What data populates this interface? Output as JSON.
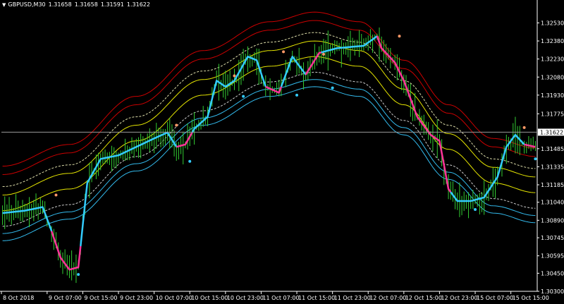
{
  "header": {
    "symbol": "GBPUSD,M30",
    "open": "1.31658",
    "high": "1.31658",
    "low": "1.31591",
    "close": "1.31622"
  },
  "colors": {
    "background": "#000000",
    "candle": "#33cc33",
    "signal_up": "#33ccff",
    "signal_down": "#ff3399",
    "band_red": "#cc0000",
    "band_yellow": "#e6e600",
    "band_cyan": "#33bbee",
    "dot_up": "#33ccff",
    "dot_down": "#ff9966"
  },
  "chart_data": {
    "type": "line",
    "current_price": 1.31622,
    "current_price_label": "1.31622",
    "ylim": [
      1.303,
      1.3265
    ],
    "y_ticks": [
      {
        "label": "1.32530",
        "value": 1.3253
      },
      {
        "label": "1.32380",
        "value": 1.3238
      },
      {
        "label": "1.32230",
        "value": 1.3223
      },
      {
        "label": "1.32080",
        "value": 1.3208
      },
      {
        "label": "1.31930",
        "value": 1.3193
      },
      {
        "label": "1.31775",
        "value": 1.31775
      },
      {
        "label": "1.31485",
        "value": 1.31485
      },
      {
        "label": "1.31335",
        "value": 1.31335
      },
      {
        "label": "1.31185",
        "value": 1.31185
      },
      {
        "label": "1.31040",
        "value": 1.3104
      },
      {
        "label": "1.30890",
        "value": 1.3089
      },
      {
        "label": "1.30745",
        "value": 1.30745
      },
      {
        "label": "1.30595",
        "value": 1.30595
      },
      {
        "label": "1.30450",
        "value": 1.3045
      },
      {
        "label": "1.30300",
        "value": 1.303
      }
    ],
    "x_ticks": [
      {
        "label": "8 Oct 2018",
        "bar": 0
      },
      {
        "label": "9 Oct 07:00",
        "bar": 20
      },
      {
        "label": "9 Oct 15:00",
        "bar": 36
      },
      {
        "label": "9 Oct 23:00",
        "bar": 52
      },
      {
        "label": "10 Oct 07:00",
        "bar": 68
      },
      {
        "label": "10 Oct 15:00",
        "bar": 84
      },
      {
        "label": "10 Oct 23:00",
        "bar": 100
      },
      {
        "label": "11 Oct 07:00",
        "bar": 116
      },
      {
        "label": "11 Oct 15:00",
        "bar": 132
      },
      {
        "label": "11 Oct 23:00",
        "bar": 148
      },
      {
        "label": "12 Oct 07:00",
        "bar": 164
      },
      {
        "label": "12 Oct 15:00",
        "bar": 180
      },
      {
        "label": "12 Oct 23:00",
        "bar": 196
      },
      {
        "label": "15 Oct 07:00",
        "bar": 212
      },
      {
        "label": "15 Oct 15:00",
        "bar": 228
      }
    ],
    "bar_count": 240,
    "price_path": [
      [
        0,
        1.3095
      ],
      [
        10,
        1.3097
      ],
      [
        18,
        1.31
      ],
      [
        22,
        1.308
      ],
      [
        26,
        1.3058
      ],
      [
        30,
        1.3048
      ],
      [
        34,
        1.305
      ],
      [
        38,
        1.312
      ],
      [
        44,
        1.314
      ],
      [
        52,
        1.3143
      ],
      [
        60,
        1.315
      ],
      [
        68,
        1.3157
      ],
      [
        74,
        1.3162
      ],
      [
        78,
        1.315
      ],
      [
        82,
        1.3152
      ],
      [
        86,
        1.3165
      ],
      [
        92,
        1.3175
      ],
      [
        96,
        1.3205
      ],
      [
        100,
        1.32
      ],
      [
        104,
        1.3205
      ],
      [
        110,
        1.3225
      ],
      [
        114,
        1.3222
      ],
      [
        118,
        1.32
      ],
      [
        124,
        1.3195
      ],
      [
        130,
        1.3225
      ],
      [
        136,
        1.321
      ],
      [
        142,
        1.3228
      ],
      [
        150,
        1.3232
      ],
      [
        156,
        1.3233
      ],
      [
        162,
        1.3234
      ],
      [
        168,
        1.3242
      ],
      [
        170,
        1.3232
      ],
      [
        176,
        1.322
      ],
      [
        180,
        1.3205
      ],
      [
        186,
        1.3175
      ],
      [
        192,
        1.316
      ],
      [
        196,
        1.3155
      ],
      [
        200,
        1.3115
      ],
      [
        204,
        1.3105
      ],
      [
        210,
        1.3105
      ],
      [
        216,
        1.3108
      ],
      [
        222,
        1.3125
      ],
      [
        226,
        1.315
      ],
      [
        230,
        1.316
      ],
      [
        234,
        1.3152
      ],
      [
        239,
        1.315
      ]
    ],
    "bands": [
      {
        "name": "red-outer",
        "color": "#cc0000",
        "offset": 0.0042,
        "dash": false
      },
      {
        "name": "red-inner",
        "color": "#cc0000",
        "offset": 0.0035,
        "dash": false
      },
      {
        "name": "white-upper",
        "color": "#ddddaa",
        "offset": 0.0025,
        "dash": true
      },
      {
        "name": "yellow-upper",
        "color": "#e6e600",
        "offset": 0.0018,
        "dash": false
      },
      {
        "name": "yellow-mid",
        "color": "#e6e600",
        "offset": 0.0005,
        "dash": false
      },
      {
        "name": "white-lower",
        "color": "#cccccc",
        "offset": -0.0008,
        "dash": true
      },
      {
        "name": "cyan-inner",
        "color": "#33bbee",
        "offset": -0.0014,
        "dash": false
      },
      {
        "name": "cyan-outer",
        "color": "#33bbee",
        "offset": -0.002,
        "dash": false
      }
    ],
    "band_center": [
      [
        0,
        1.3092
      ],
      [
        30,
        1.311
      ],
      [
        60,
        1.315
      ],
      [
        90,
        1.3188
      ],
      [
        120,
        1.3212
      ],
      [
        140,
        1.322
      ],
      [
        160,
        1.3212
      ],
      [
        180,
        1.318
      ],
      [
        200,
        1.3143
      ],
      [
        220,
        1.3115
      ],
      [
        239,
        1.3107
      ]
    ],
    "signal_dots": [
      {
        "bar": 24,
        "price": 1.311,
        "kind": "down"
      },
      {
        "bar": 34,
        "price": 1.3044,
        "kind": "up"
      },
      {
        "bar": 78,
        "price": 1.3168,
        "kind": "down"
      },
      {
        "bar": 84,
        "price": 1.3138,
        "kind": "up"
      },
      {
        "bar": 104,
        "price": 1.3209,
        "kind": "down"
      },
      {
        "bar": 108,
        "price": 1.3192,
        "kind": "up"
      },
      {
        "bar": 126,
        "price": 1.3229,
        "kind": "down"
      },
      {
        "bar": 132,
        "price": 1.3193,
        "kind": "up"
      },
      {
        "bar": 144,
        "price": 1.3227,
        "kind": "down"
      },
      {
        "bar": 148,
        "price": 1.3199,
        "kind": "up"
      },
      {
        "bar": 178,
        "price": 1.3242,
        "kind": "down"
      },
      {
        "bar": 212,
        "price": 1.3098,
        "kind": "up"
      },
      {
        "bar": 234,
        "price": 1.3166,
        "kind": "down"
      },
      {
        "bar": 239,
        "price": 1.314,
        "kind": "up"
      }
    ],
    "down_segments": [
      [
        22,
        34
      ],
      [
        78,
        84
      ],
      [
        118,
        124
      ],
      [
        136,
        142
      ],
      [
        168,
        200
      ],
      [
        234,
        239
      ]
    ]
  }
}
